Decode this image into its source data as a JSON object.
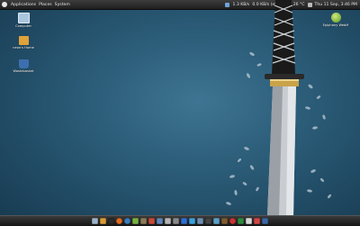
{
  "top_panel": {
    "menus": [
      "Applications",
      "Places",
      "System"
    ],
    "tray_left": "1.3 KB/s",
    "tray_mid": "0.0 KB/s (eth0)",
    "temperature": "26 °C",
    "datetime": "Thu 11 Sep, 3:46 PM"
  },
  "desktop": {
    "icons": [
      {
        "label": "Computer",
        "color": "#a9c6de"
      },
      {
        "label": "neon's Home",
        "color": "#e0a23a"
      },
      {
        "label": "Wastebasket",
        "color": "#3d6fb0"
      }
    ],
    "right_icon": {
      "label": "Epiphany WebM",
      "color": "#7bb33f"
    }
  },
  "dock": {
    "launchers": [
      {
        "name": "files-icon",
        "color": "#9db4c8"
      },
      {
        "name": "home-folder-icon",
        "color": "#d99a38"
      },
      {
        "name": "terminal-icon",
        "color": "#2b2b2b"
      },
      {
        "name": "firefox-icon",
        "color": "#e46b1f"
      },
      {
        "name": "globe-icon",
        "color": "#3c7dbf"
      },
      {
        "name": "chat-icon",
        "color": "#77b243"
      },
      {
        "name": "gimp-icon",
        "color": "#8c7a5a"
      },
      {
        "name": "photos-icon",
        "color": "#c74a3a"
      },
      {
        "name": "mail-icon",
        "color": "#5d86b9"
      },
      {
        "name": "music-icon",
        "color": "#b5b5b5"
      },
      {
        "name": "settings-icon",
        "color": "#8a8a8a"
      },
      {
        "name": "ftp-icon",
        "color": "#2f6fd1"
      },
      {
        "name": "office-icon",
        "color": "#3aa0dd"
      },
      {
        "name": "monitor-icon",
        "color": "#6d8fb3"
      },
      {
        "name": "video-icon",
        "color": "#444444"
      },
      {
        "name": "network-icon",
        "color": "#5aa0c8"
      },
      {
        "name": "dictionary-icon",
        "color": "#7d5c2e"
      },
      {
        "name": "browser-icon",
        "color": "#cc3333"
      },
      {
        "name": "download-icon",
        "color": "#2e8a3e"
      },
      {
        "name": "editor-icon",
        "color": "#d8d8d8"
      },
      {
        "name": "calendar-icon",
        "color": "#cf4747"
      },
      {
        "name": "trash-icon",
        "color": "#3b66a5"
      }
    ]
  }
}
